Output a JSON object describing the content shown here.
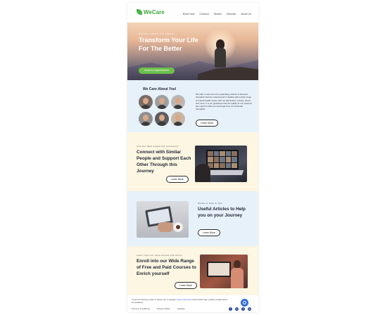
{
  "colors": {
    "brand_green": "#3ea83c",
    "cta_green": "#6cc04a",
    "blue_section": "#e7f1fa",
    "cream_section": "#fdf6e3",
    "link_blue": "#2f6bd8"
  },
  "header": {
    "logo": "WeCare",
    "nav": [
      "Book Now",
      "Connect",
      "Stories",
      "Educate",
      "About Us"
    ]
  },
  "hero": {
    "eyebrow": "WE'RE HERE TO HELP!",
    "title": "Transform Your Life For The Better",
    "cta": "Book An Appointment"
  },
  "about": {
    "title": "We Care About You!",
    "text": "We offer a vast and ever-expanding network of licensed therapists that are experienced in dealing with a wide range of mental health issues such as depression, anxiety, stress and more. It is our guarantee that the quality of our sessions are equal to what you would get from conventional therapists.",
    "cta": "Learn More"
  },
  "community": {
    "eyebrow": "Join Our Well-supported Community",
    "title": "Connect with Similar People and Support Each Other Through this Journey",
    "cta": "Learn More"
  },
  "articles": {
    "eyebrow": "Words of Help & Tips",
    "title": "Useful Articles to Help you on your Journey",
    "cta": "Learn More"
  },
  "courses": {
    "eyebrow": "Learn from our experienced instructors",
    "title": "Enroll into our Wide Range of Free and Paid Courses to Enrich yourself",
    "cta": "Learn More"
  },
  "footer": {
    "text_before": "If you are facing a crisis or others are in danger, ",
    "link": "these resources",
    "text_after": " will provide help, please contact them immediately.",
    "links": [
      "Terms & Conditions",
      "Privacy Policy",
      "Cookies"
    ],
    "socials": [
      "f",
      "in",
      "t",
      "ig"
    ]
  }
}
